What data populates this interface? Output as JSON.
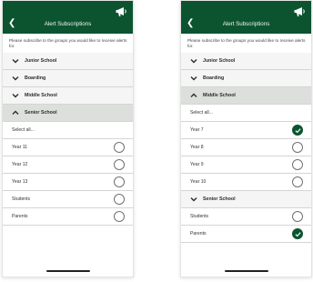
{
  "colors": {
    "nav_bg": "#0c5430",
    "checked": "#0c5430"
  },
  "screens": [
    {
      "back_icon": "chevron-left-icon",
      "title": "Alert Subscriptions",
      "action_icon": "megaphone-icon",
      "intro": "Please subscribe to the groups you would like to receive alerts for.",
      "items": [
        {
          "kind": "group",
          "label": "Junior School",
          "icon": "chevron-down-icon"
        },
        {
          "kind": "group",
          "label": "Boarding",
          "icon": "chevron-down-icon"
        },
        {
          "kind": "group",
          "label": "Middle School",
          "icon": "chevron-down-icon"
        },
        {
          "kind": "group",
          "label": "Senior School",
          "icon": "chevron-up-icon",
          "open": true
        },
        {
          "kind": "select",
          "label": "Select all..."
        },
        {
          "kind": "leaf",
          "label": "Year 11",
          "checked": false
        },
        {
          "kind": "leaf",
          "label": "Year 12",
          "checked": false
        },
        {
          "kind": "leaf",
          "label": "Year 13",
          "checked": false
        },
        {
          "kind": "leaf",
          "label": "Students",
          "checked": false
        },
        {
          "kind": "leaf",
          "label": "Parents",
          "checked": false
        }
      ]
    },
    {
      "back_icon": "chevron-left-icon",
      "title": "Alert Subscriptions",
      "action_icon": "megaphone-icon",
      "intro": "Please subscribe to the groups you would like to receive alerts for.",
      "items": [
        {
          "kind": "group",
          "label": "Junior School",
          "icon": "chevron-down-icon"
        },
        {
          "kind": "group",
          "label": "Boarding",
          "icon": "chevron-down-icon"
        },
        {
          "kind": "group",
          "label": "Middle School",
          "icon": "chevron-up-icon",
          "open": true
        },
        {
          "kind": "select",
          "label": "Select all..."
        },
        {
          "kind": "leaf",
          "label": "Year 7",
          "checked": true
        },
        {
          "kind": "leaf",
          "label": "Year 8",
          "checked": false
        },
        {
          "kind": "leaf",
          "label": "Year 9",
          "checked": false
        },
        {
          "kind": "leaf",
          "label": "Year 10",
          "checked": false
        },
        {
          "kind": "group",
          "label": "Senior School",
          "icon": "chevron-down-icon"
        },
        {
          "kind": "leaf",
          "label": "Students",
          "checked": false
        },
        {
          "kind": "leaf",
          "label": "Parents",
          "checked": true
        }
      ]
    }
  ]
}
